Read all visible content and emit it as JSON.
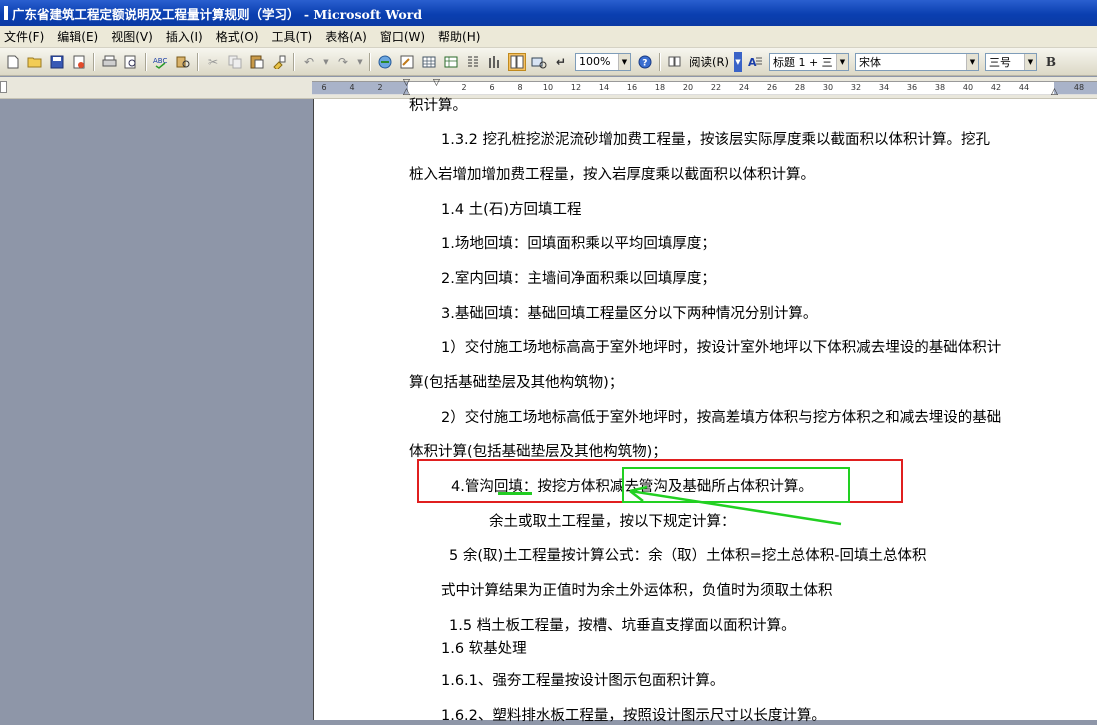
{
  "window": {
    "title": "广东省建筑工程定额说明及工程量计算规则（学习） - Microsoft Word"
  },
  "menu": [
    "文件(F)",
    "编辑(E)",
    "视图(V)",
    "插入(I)",
    "格式(O)",
    "工具(T)",
    "表格(A)",
    "窗口(W)",
    "帮助(H)"
  ],
  "toolbar": {
    "zoom": "100%",
    "read_label": "阅读(R)",
    "style": "标题 1 + 三",
    "font": "宋体",
    "size": "三号",
    "bold": "B"
  },
  "ruler": {
    "ticks": [
      "6",
      "4",
      "2",
      "2",
      "4",
      "6",
      "8",
      "10",
      "12",
      "14",
      "16",
      "18",
      "20",
      "22",
      "24",
      "26",
      "28",
      "30",
      "32",
      "34",
      "36",
      "38",
      "40",
      "42",
      "44",
      "48"
    ]
  },
  "document": {
    "lines": [
      "积计算。",
      "1.3.2 挖孔桩挖淤泥流砂增加费工程量，按该层实际厚度乘以截面积以体积计算。挖孔",
      "桩入岩增加增加费工程量，按入岩厚度乘以截面积以体积计算。",
      "1.4 土(石)方回填工程",
      "1.场地回填：回填面积乘以平均回填厚度；",
      "2.室内回填：主墙间净面积乘以回填厚度；",
      "3.基础回填：基础回填工程量区分以下两种情况分别计算。",
      "1）交付施工场地标高高于室外地坪时，按设计室外地坪以下体积减去埋设的基础体积计",
      "算(包括基础垫层及其他构筑物)；",
      "2）交付施工场地标高低于室外地坪时，按高差填方体积与挖方体积之和减去埋设的基础",
      "体积计算(包括基础垫层及其他构筑物)；",
      "4.管沟回填：按挖方体积减去管沟及基础所占体积计算。",
      "余土或取土工程量，按以下规定计算：",
      "5 余(取)土工程量按计算公式：余（取）土体积=挖土总体积-回填土总体积",
      "式中计算结果为正值时为余土外运体积，负值时为须取土体积",
      "1.5 档土板工程量，按槽、坑垂直支撑面以面积计算。",
      "1.6  软基处理",
      "1.6.1、强夯工程量按设计图示包面积计算。",
      "1.6.2、塑料排水板工程量，按照设计图示尺寸以长度计算。"
    ]
  },
  "annotations": {
    "red_box_color": "#e01f1f",
    "green_color": "#22d022"
  }
}
